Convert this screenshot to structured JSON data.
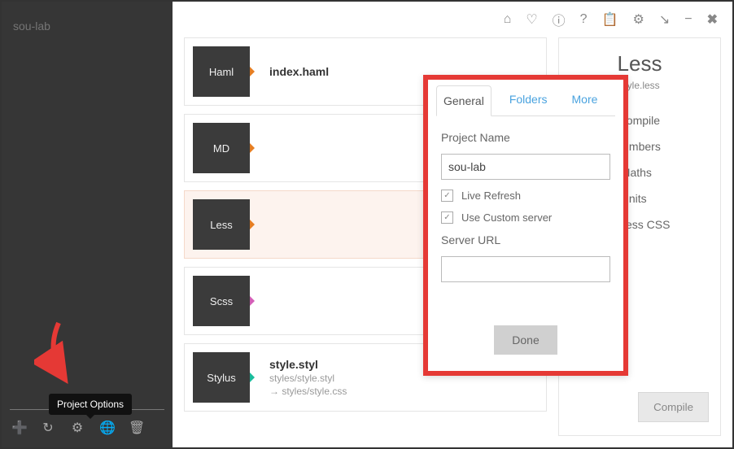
{
  "sidebar": {
    "project_name": "sou-lab",
    "tooltip": "Project Options",
    "icons": [
      "plus-icon",
      "refresh-icon",
      "gear-icon",
      "globe-icon",
      "trash-icon"
    ]
  },
  "topbar_icons": [
    "home-icon",
    "heart-icon",
    "info-icon",
    "help-icon",
    "clipboard-icon",
    "gear-icon",
    "arrow-icon",
    "minimize-icon",
    "close-icon"
  ],
  "files": [
    {
      "badge": "Haml",
      "title": "index.haml",
      "path": "",
      "out": "",
      "pointer": "orange"
    },
    {
      "badge": "MD",
      "title": "",
      "path": "",
      "out": "",
      "pointer": "orange"
    },
    {
      "badge": "Less",
      "title": "",
      "path": "",
      "out": "",
      "pointer": "orange",
      "highlighted": true
    },
    {
      "badge": "Scss",
      "title": "",
      "path": "",
      "out": "",
      "pointer": "pink"
    },
    {
      "badge": "Stylus",
      "title": "style.styl",
      "path": "styles/style.styl",
      "out": "→ styles/style.css",
      "pointer": "teal"
    }
  ],
  "right": {
    "title": "Less",
    "sub": "style.less",
    "options": [
      {
        "label": "Auto Compile",
        "checked": true
      },
      {
        "label": "Line numbers",
        "checked": false
      },
      {
        "label": "Strict Maths",
        "checked": false
      },
      {
        "label": "Strict Units",
        "checked": false
      },
      {
        "label": "Compress CSS",
        "checked": true
      }
    ],
    "compile": "Compile"
  },
  "dialog": {
    "tabs": [
      "General",
      "Folders",
      "More"
    ],
    "project_name_label": "Project Name",
    "project_name_value": "sou-lab",
    "live_refresh_label": "Live Refresh",
    "custom_server_label": "Use Custom server",
    "server_url_label": "Server URL",
    "server_url_value": "",
    "done": "Done"
  }
}
